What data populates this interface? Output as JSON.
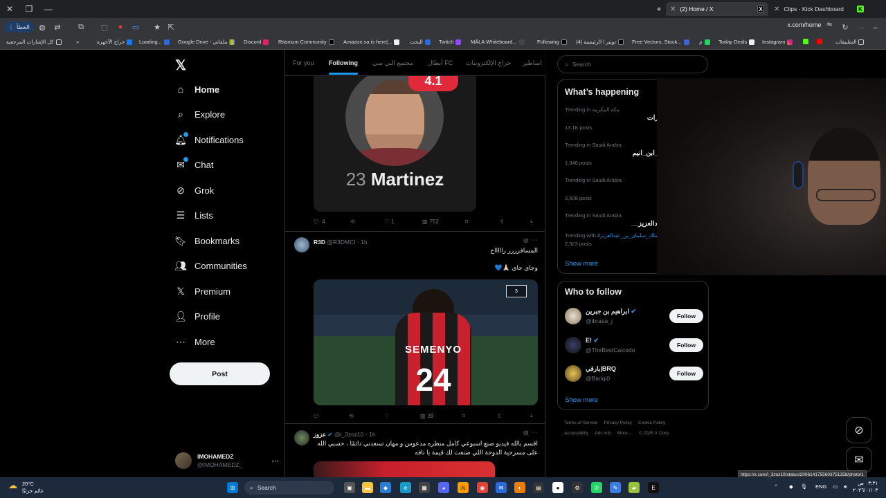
{
  "browser": {
    "tabs": [
      {
        "label": "(2) Home / X",
        "active": true
      },
      {
        "label": "Clips - Kick Dashboard",
        "active": false
      }
    ],
    "url": "x.com/home",
    "error_pill": "الخطأ",
    "bookmarks": [
      "كل الإشارات المرجعية",
      "حراج الأجهزة",
      "Loading...",
      "Google Drive - ملفاتي",
      "Discord",
      "Ritanium Community",
      "Amazon.sa is here|...",
      "البحث",
      "Twitch",
      "MÅLA Whiteboard...",
      "Following",
      "(4) تويتر \\ الرئيسية",
      "Free Vectors, Stock...",
      "م",
      "Today Deals",
      "Instagram",
      "التطبيقات"
    ],
    "status_url": "https://x.com/i_3zoz10/status/2006141755603751358/photo/1"
  },
  "nav": {
    "items": [
      "Home",
      "Explore",
      "Notifications",
      "Chat",
      "Grok",
      "Lists",
      "Bookmarks",
      "Communities",
      "Premium",
      "Profile",
      "More"
    ],
    "post_label": "Post",
    "account": {
      "name": "IMOHAMEDZ",
      "handle": "@IMOHAMEDZ_"
    }
  },
  "feed": {
    "tabs": [
      "For you",
      "Following",
      "مجتمع البي سي",
      "أبطال FC",
      "حراج الإلكترونيات",
      "اساطير"
    ],
    "active_tab": "Following",
    "card1": {
      "rating": "4.1",
      "number": "23",
      "name": "Martinez"
    },
    "tweet1_actions": {
      "replies": "4",
      "retweets": "",
      "likes": "1",
      "views": "752"
    },
    "tweet2": {
      "name": "R3D",
      "handle": "@R3DMCI",
      "time": "1h",
      "line1": "المسافرررر راااااح",
      "line2": "وجاي جاي 🙏🏻💙",
      "jersey_name": "SEMENYO",
      "jersey_number": "24",
      "badge": "3",
      "views": "39"
    },
    "tweet3": {
      "name": "عزوز",
      "handle": "@i_3zoz10",
      "time": "1h",
      "text": "اقسم بالله فيديو صنع اسبوعي كامل منظره مدعوس و مهان تسعدني دائمًا ، حسبي الله على مسرحية الدوحة اللي صنعت لك قيمة يا تافه"
    }
  },
  "sidebar": {
    "search_placeholder": "Search",
    "happening_title": "What’s happening",
    "trends": [
      {
        "context": "Trending in مكة المكرمة",
        "name": "مارات",
        "posts": "13.1K posts"
      },
      {
        "context": "Trending in Saudi Arabia",
        "name": "ـه_ابن_انيم",
        "posts": "1,346 posts"
      },
      {
        "context": "Trending in Saudi Arabia",
        "name": "",
        "posts": "3,508 posts"
      },
      {
        "context": "Trending in Saudi Arabia",
        "name": "عبدالعزيز__",
        "posts": "2,923 posts",
        "with": "Trending with",
        "with_tag": "#الملك_سلمان_بن_عبدالعزيز"
      }
    ],
    "show_more": "Show more",
    "who_title": "Who to follow",
    "who": [
      {
        "name": "ابراهيم بن جبرين",
        "handle": "@ibraaa_j"
      },
      {
        "name": "E!",
        "handle": "@TheBestCaicedo"
      },
      {
        "name": "بارقي|BRQ",
        "handle": "@Bariqi0"
      }
    ],
    "follow_label": "Follow",
    "show_more2": "Show more",
    "footer": [
      "Terms of Service",
      "Privacy Policy",
      "Cookie Policy",
      "Accessibility",
      "Ads info",
      "More ...",
      "© 2025 X Corp."
    ]
  },
  "taskbar": {
    "temp": "20°C",
    "weather": "غائم جزئيًا",
    "search": "Search",
    "lang": "ENG",
    "time": "٠٣:٣١ ص",
    "date": "٢٠٢٦/٠١/٠٣"
  }
}
